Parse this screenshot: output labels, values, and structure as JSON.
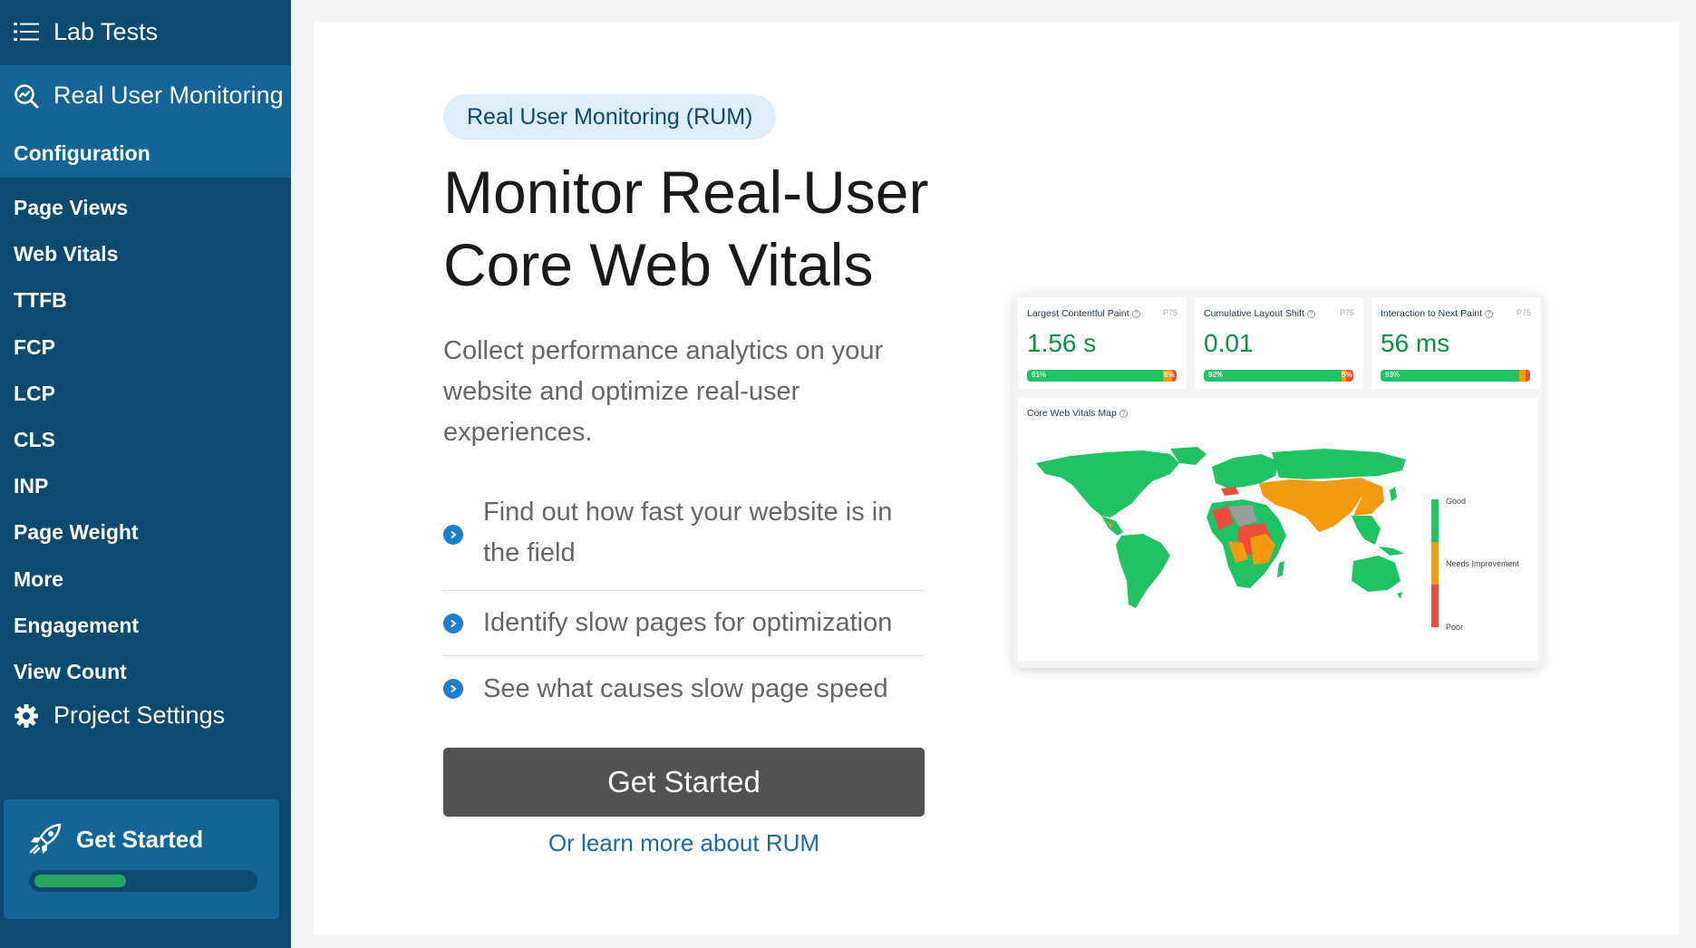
{
  "sidebar": {
    "lab_tests": "Lab Tests",
    "rum": "Real User Monitoring",
    "configuration": "Configuration",
    "items": [
      "Page Views",
      "Web Vitals",
      "TTFB",
      "FCP",
      "LCP",
      "CLS",
      "INP",
      "Page Weight",
      "More",
      "Engagement",
      "View Count"
    ],
    "project_settings": "Project Settings",
    "get_started": {
      "label": "Get Started",
      "progress": 0.42
    }
  },
  "main": {
    "badge": "Real User Monitoring (RUM)",
    "headline_line1": "Monitor Real-User",
    "headline_line2": "Core Web Vitals",
    "lead": "Collect performance analytics on your website and optimize real-user experiences.",
    "features": [
      "Find out how fast your website is in the field",
      "Identify slow pages for optimization",
      "See what causes slow page speed"
    ],
    "cta": "Get Started",
    "learn_more": "Or learn more about RUM"
  },
  "preview": {
    "metrics": [
      {
        "title": "Largest Contentful Paint",
        "percentile": "P75",
        "value": "1.56 s",
        "good": 91,
        "ni": 6,
        "poor": 3,
        "good_label": "91%",
        "ni_label": "6%"
      },
      {
        "title": "Cumulative Layout Shift",
        "percentile": "P75",
        "value": "0.01",
        "good": 92,
        "ni": 3,
        "poor": 5,
        "good_label": "92%",
        "poor_label": "5%"
      },
      {
        "title": "Interaction to Next Paint",
        "percentile": "P75",
        "value": "56 ms",
        "good": 93,
        "ni": 4,
        "poor": 3,
        "good_label": "93%"
      }
    ],
    "map_title": "Core Web Vitals Map",
    "legend": [
      "Good",
      "Needs Improvement",
      "Poor"
    ]
  },
  "colors": {
    "sidebar_bg": "#0c4a72",
    "sidebar_active": "#136597",
    "good": "#1ec463",
    "needs_improvement": "#f49b0d",
    "poor": "#ef4b3e",
    "link": "#1a6aa8",
    "value_green": "#0b8f43"
  },
  "icons": {
    "lab_tests": "list-icon",
    "rum": "search-chart-icon",
    "project_settings": "gear-icon",
    "get_started": "rocket-icon",
    "feature": "chevron-right-circle-icon"
  }
}
